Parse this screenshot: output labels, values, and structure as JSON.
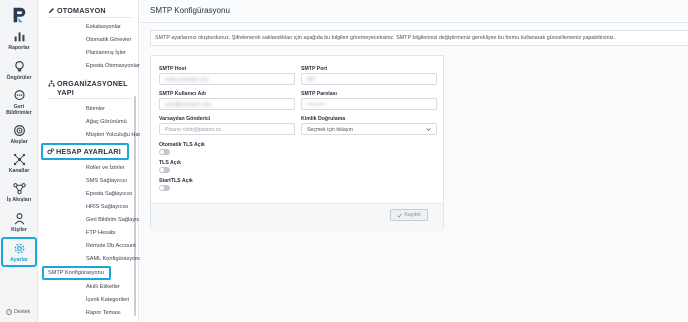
{
  "rail": {
    "items": [
      {
        "label": "Raporlar",
        "icon": "bar-chart-icon"
      },
      {
        "label": "Öngörüler",
        "icon": "lightbulb-icon"
      },
      {
        "label": "Geri Bildirimler",
        "icon": "chat-bubble-icon"
      },
      {
        "label": "Akışlar",
        "icon": "target-icon"
      },
      {
        "label": "Kanallar",
        "icon": "network-icon"
      },
      {
        "label": "İş Akışları",
        "icon": "workflow-icon"
      },
      {
        "label": "Kişiler",
        "icon": "person-icon"
      },
      {
        "label": "Ayarlar",
        "icon": "gear-icon"
      }
    ],
    "support_label": "Destek"
  },
  "submenu": {
    "automation_title": "OTOMASYON",
    "automation_items": [
      "Eskalasyonlar",
      "Otomatik Görevler",
      "Planlanmış İşler",
      "Eposta Otomasyonları"
    ],
    "org_title": "ORGANİZASYONEL YAPI",
    "org_items": [
      "Birimler",
      "Ağaç Görünümü",
      "Müşteri Yolculuğu Haritaları"
    ],
    "account_title": "HESAP AYARLARI",
    "account_items": [
      "Roller ve İzinler",
      "SMS Sağlayıcısı",
      "Eposta Sağlayıcısı",
      "HRIS Sağlayıcısı",
      "Geri Bildirim Sağlayıcısı",
      "FTP Hesabı",
      "Remote Db Account",
      "SAML Konfigürasyonu",
      "SMTP Konfigürasyonu",
      "Akıllı Etiketler",
      "İçerik Kategorileri",
      "Rapor Teması"
    ]
  },
  "main": {
    "title": "SMTP Konfigürasyonu",
    "info": "SMTP ayarlarınız oluşturdunuz. Şifrelenerek saklandıkları için aşağıda bu bilgileri göremeyeceksiniz. SMTP bilgilerinizi değiştirmeniz gerekliyse bu formu kullanarak güncellemeniz yapabilirsiniz.",
    "form": {
      "host_label": "SMTP Host",
      "host_value": "smtp.example.com",
      "port_label": "SMTP Port",
      "port_value": "587",
      "user_label": "SMTP Kullanıcı Adı",
      "user_value": "user@example.com",
      "pass_label": "SMTP Parolası",
      "pass_value": "••••••••••",
      "sender_label": "Varsayılan Gönderici",
      "sender_placeholder": "Pisano <info@pisano.co",
      "auth_label": "Kimlik Doğrulama",
      "auth_value": "Seçmek için tıklayın",
      "auto_tls_label": "Otomatik TLS Açık",
      "tls_label": "TLS Açık",
      "starttls_label": "StartTLS Açık",
      "save_label": "Kaydet"
    }
  },
  "colors": {
    "accent": "#1aa7d9",
    "brand": "#2b3a55"
  }
}
